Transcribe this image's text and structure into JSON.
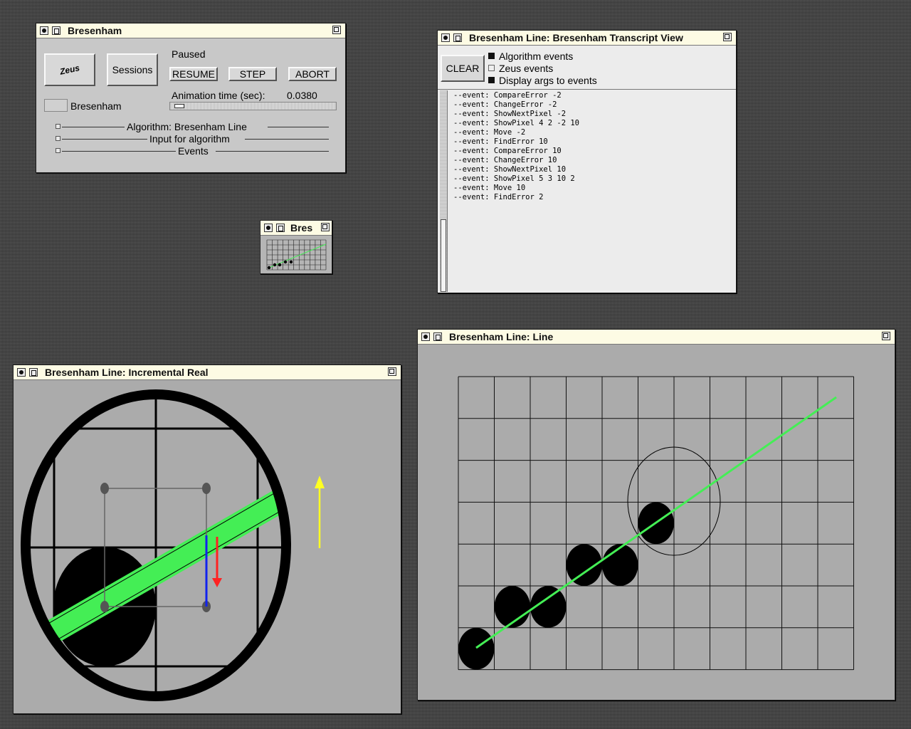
{
  "control_panel": {
    "title": "Bresenham",
    "logo_text": "Zeus",
    "sessions_label": "Sessions",
    "status": "Paused",
    "resume_label": "RESUME",
    "step_label": "STEP",
    "abort_label": "ABORT",
    "anim_time_label": "Animation time (sec):",
    "anim_time_value": "0.0380",
    "algorithm_name": "Bresenham",
    "section_algorithm": "Algorithm:  Bresenham Line",
    "section_input": "Input for algorithm",
    "section_events": "Events"
  },
  "mini_window": {
    "title": "Bres"
  },
  "transcript": {
    "title": "Bresenham Line: Bresenham Transcript View",
    "clear_label": "CLEAR",
    "options": [
      {
        "label": "Algorithm events",
        "checked": true
      },
      {
        "label": "Zeus events",
        "checked": false
      },
      {
        "label": "Display args to events",
        "checked": true
      }
    ],
    "lines": [
      "--event: CompareError -2",
      "--event: ChangeError -2",
      "--event: ShowNextPixel -2",
      "--event: ShowPixel 4 2 -2 10",
      "--event: Move -2",
      "--event: FindError 10",
      "--event: CompareError 10",
      "--event: ChangeError 10",
      "--event: ShowNextPixel 10",
      "--event: ShowPixel 5 3 10 2",
      "--event: Move 10",
      "--event: FindError 2"
    ]
  },
  "incremental_view": {
    "title": "Bresenham Line: Incremental Real"
  },
  "line_view": {
    "title": "Bresenham Line: Line",
    "grid_cols": 11,
    "grid_rows": 7,
    "pixels": [
      [
        0,
        0
      ],
      [
        1,
        1
      ],
      [
        2,
        1
      ],
      [
        3,
        2
      ],
      [
        4,
        2
      ],
      [
        5,
        3
      ]
    ],
    "probe_pixel": [
      5.5,
      3.5
    ],
    "line_color": "#44ee55"
  },
  "colors": {
    "line_green": "#44ee55",
    "arrow_yellow": "#ffff22",
    "arrow_red": "#ff2222",
    "error_blue": "#1122ee",
    "canvas_gray": "#ababab"
  }
}
